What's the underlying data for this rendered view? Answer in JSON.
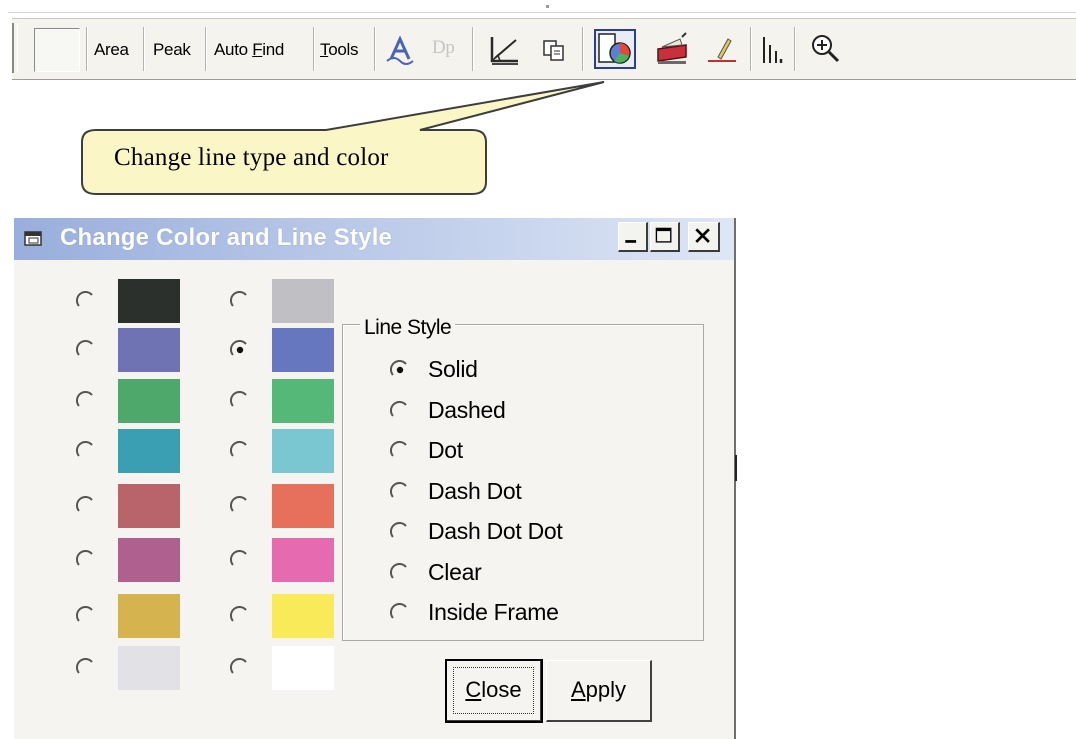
{
  "toolbar": {
    "buttons": {
      "area": "Area",
      "peak": "Peak",
      "auto_find_prefix": "Auto ",
      "auto_find_hot": "F",
      "auto_find_rest": "ind",
      "tools_hot": "T",
      "tools_rest": "ools",
      "dp": "Dp"
    },
    "icons": [
      "text-a-icon",
      "measure-icon",
      "copy-icon",
      "color-style-icon",
      "print-icon",
      "draw-line-icon",
      "bars-icon",
      "zoom-in-icon"
    ]
  },
  "callout": {
    "text": "Change line type and color"
  },
  "dialog": {
    "title": "Change Color and Line Style",
    "colors_left": [
      "#2c302d",
      "#6f73b3",
      "#4ea76b",
      "#3a9fb3",
      "#b8646a",
      "#b0608f",
      "#d5b34e",
      "#e2e2e6"
    ],
    "colors_right": [
      "#c0bfc4",
      "#6677c0",
      "#55b878",
      "#7ac7d2",
      "#e6705c",
      "#e66ab0",
      "#f8ea58",
      "#ffffff"
    ],
    "selected_color": "right-2",
    "line_style": {
      "title": "Line Style",
      "options": [
        "Solid",
        "Dashed",
        "Dot",
        "Dash Dot",
        "Dash Dot Dot",
        "Clear",
        "Inside Frame"
      ],
      "selected": "Solid"
    },
    "close_hot": "C",
    "close_rest": "lose",
    "apply_hot": "A",
    "apply_rest": "pply"
  }
}
